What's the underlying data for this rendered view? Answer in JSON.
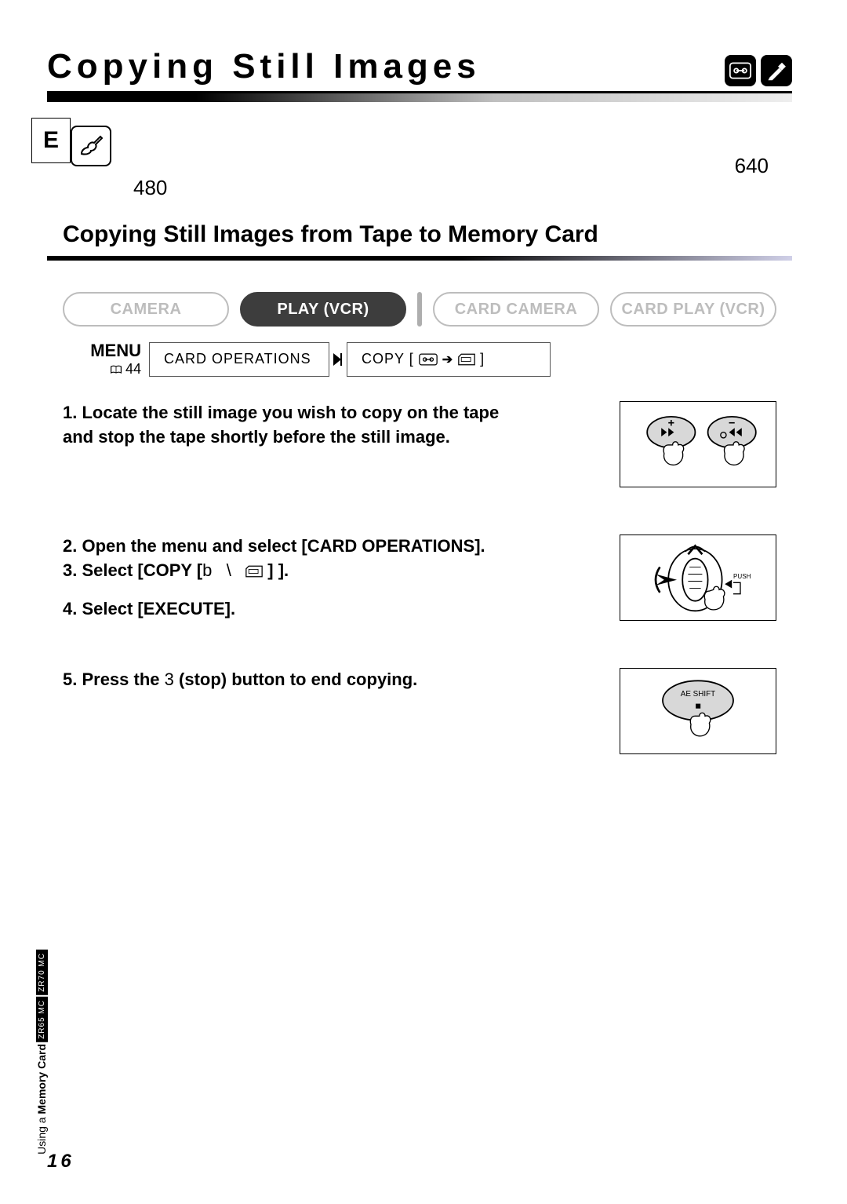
{
  "header": {
    "title": "Copying Still Images",
    "icon1_name": "tape-icon",
    "icon2_name": "pen-icon"
  },
  "e_tab": "E",
  "intro": {
    "num_left": "480",
    "num_right": "640"
  },
  "section": {
    "heading": "Copying Still Images from Tape to Memory Card"
  },
  "modes": {
    "camera": "CAMERA",
    "play": "PLAY (VCR)",
    "card_camera": "CARD CAMERA",
    "card_play": "CARD PLAY (VCR)"
  },
  "menu": {
    "label": "MENU",
    "ref": "44",
    "path1": "CARD OPERATIONS",
    "path2_prefix": "COPY [",
    "path2_suffix": "]"
  },
  "steps": {
    "s1": "1. Locate the still image you wish to copy on the tape and stop the tape shortly before the still image.",
    "s2": "2. Open the menu and select [CARD OPERATIONS].",
    "s3a": "3. Select [COPY [",
    "s3b": "b",
    "s3c": "\\",
    "s3d": "] ].",
    "s4": "4. Select [EXECUTE].",
    "s5a": "5. Press the ",
    "s5b": "3",
    "s5c": " (stop) button to end copying."
  },
  "fig3": {
    "label": "AE SHIFT",
    "stop": "■"
  },
  "fig2": {
    "push": "PUSH"
  },
  "side": {
    "model1": "ZR70 MC",
    "model2": "ZR65 MC",
    "text_prefix": "Using a ",
    "text_bold": "Memory Card"
  },
  "page_number": "16"
}
